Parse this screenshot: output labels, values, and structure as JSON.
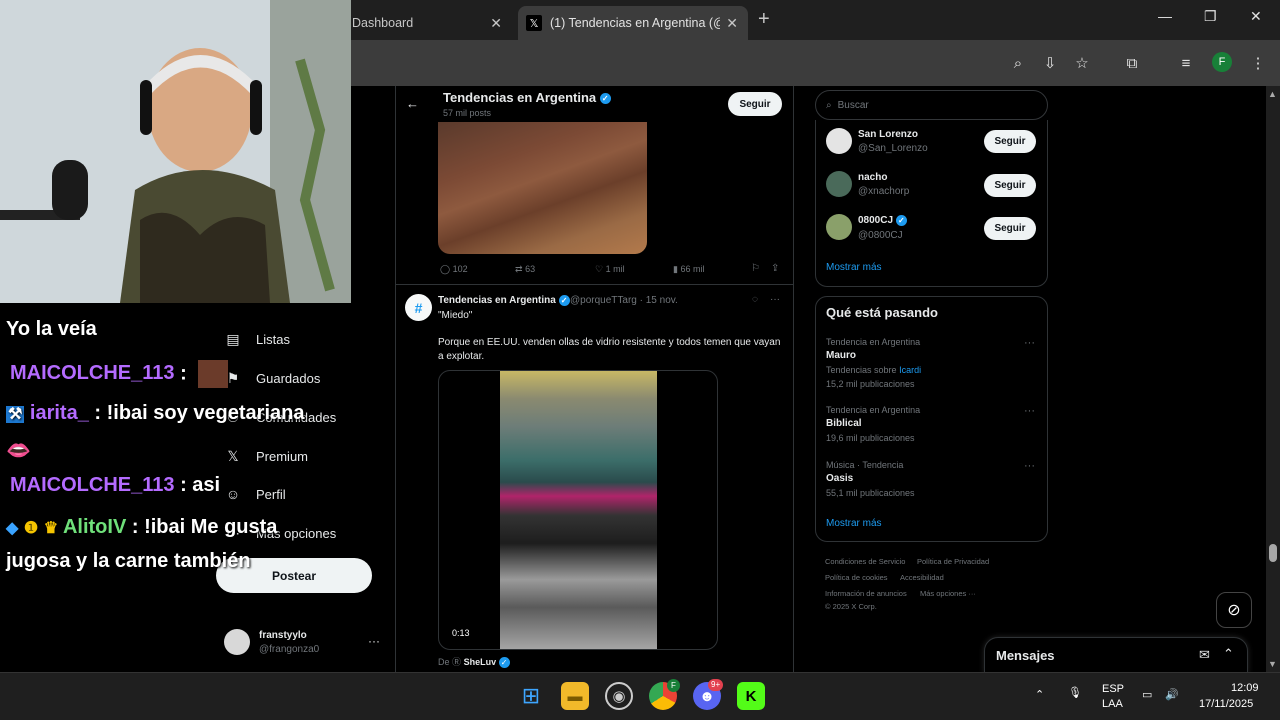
{
  "browser": {
    "tabs": [
      {
        "title": "Dashboard",
        "active": false
      },
      {
        "title": "(1) Tendencias en Argentina (@",
        "active": true
      }
    ],
    "new_tab": "+",
    "profile_initial": "F"
  },
  "left_nav": {
    "items": [
      {
        "label": "Listas",
        "icon": "list-icon"
      },
      {
        "label": "Guardados",
        "icon": "bookmark-icon"
      },
      {
        "label": "Comunidades",
        "icon": "communities-icon"
      },
      {
        "label": "Premium",
        "icon": "x-logo-icon"
      },
      {
        "label": "Perfil",
        "icon": "profile-icon"
      },
      {
        "label": "Más opciones",
        "icon": "more-circle-icon"
      }
    ],
    "post_button": "Postear",
    "account": {
      "name": "franstyylo",
      "handle": "@frangonza0"
    }
  },
  "timeline": {
    "header": {
      "name": "Tendencias en Argentina",
      "posts_count": "57 mil posts",
      "follow": "Seguir"
    },
    "tweet1_actions": {
      "replies": "102",
      "reposts": "63",
      "likes": "1 mil",
      "views": "66 mil"
    },
    "tweet2": {
      "name": "Tendencias en Argentina",
      "handle": "@porqueTTarg · 15 nov.",
      "text1": "\"Miedo\"",
      "text2": "Porque en EE.UU. venden ollas de vidrio resistente y todos temen que vayan a explotar.",
      "video_time": "0:13",
      "from_label": "De",
      "from_name": "SheLuv"
    }
  },
  "sidebar": {
    "search_placeholder": "Buscar",
    "who_to_follow": [
      {
        "name": "San Lorenzo",
        "handle": "@San_Lorenzo",
        "button": "Seguir"
      },
      {
        "name": "nacho",
        "handle": "@xnachorp",
        "button": "Seguir"
      },
      {
        "name": "0800CJ",
        "handle": "@0800CJ",
        "button": "Seguir"
      }
    ],
    "show_more": "Mostrar más",
    "trends_title": "Qué está pasando",
    "trends": [
      {
        "meta": "Tendencia en Argentina",
        "title": "Mauro",
        "sub_prefix": "Tendencias sobre",
        "sub_link": "Icardi",
        "count": "15,2 mil publicaciones"
      },
      {
        "meta": "Tendencia en Argentina",
        "title": "Biblical",
        "count": "19,6 mil publicaciones"
      },
      {
        "meta": "Música · Tendencia",
        "title": "Oasis",
        "count": "55,1 mil publicaciones"
      }
    ],
    "trends_show_more": "Mostrar más",
    "footer": {
      "terms": "Condiciones de Servicio",
      "privacy": "Política de Privacidad",
      "cookies": "Política de cookies",
      "accessibility": "Accesibilidad",
      "ads": "Información de anuncios",
      "more": "Más opciones ···",
      "copyright": "© 2025 X Corp."
    },
    "messages": "Mensajes"
  },
  "stream_chat": [
    {
      "user": "",
      "text": "Yo la veía"
    },
    {
      "user": "MAICOLCHE_113",
      "text": ":"
    },
    {
      "user": "iarita_",
      "text": ": !ibai soy vegetariana"
    },
    {
      "user": "MAICOLCHE_113",
      "text": ": asi"
    },
    {
      "user": "AlitoIV",
      "text": ": !ibai Me gusta"
    },
    {
      "user": "",
      "text": "jugosa y la carne también"
    }
  ],
  "taskbar": {
    "language": "ESP",
    "layout": "LAA",
    "time": "12:09",
    "date": "17/11/2025",
    "discord_badge": "9+",
    "chrome_badge": "F"
  },
  "colors": {
    "accent": "#1d9bf0",
    "chat_purple": "#b46bff",
    "chat_green": "#6fe07a"
  }
}
